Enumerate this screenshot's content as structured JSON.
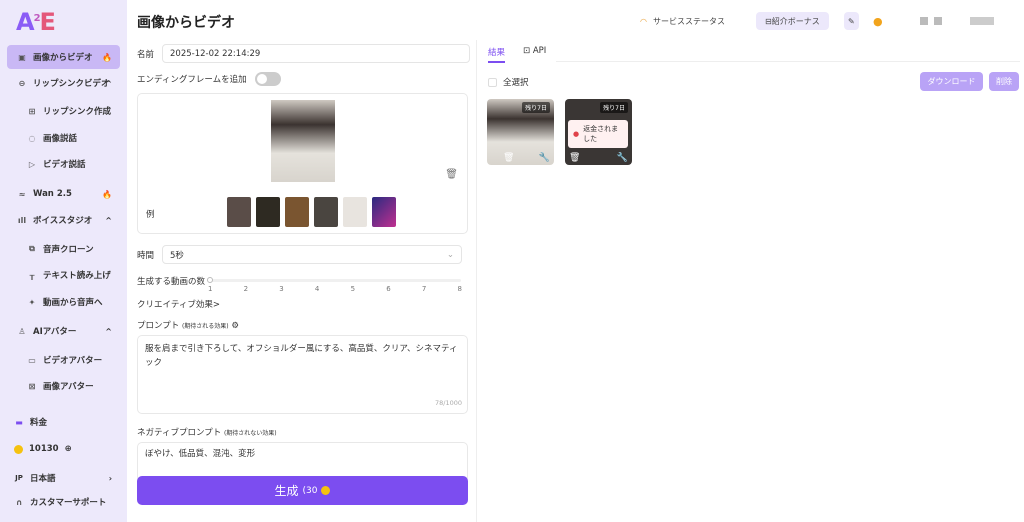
{
  "sidebar": {
    "logo": "A2E",
    "items": [
      {
        "label": "画像からビデオ",
        "icon": "image-video-icon"
      },
      {
        "label": "リップシンクビデオ",
        "icon": "lips-icon"
      },
      {
        "label": "リップシンク作成",
        "icon": "plus-square-icon"
      },
      {
        "label": "画像説話",
        "icon": "talk-icon"
      },
      {
        "label": "ビデオ説話",
        "icon": "video-talk-icon"
      },
      {
        "label": "Wan 2.5",
        "icon": "wan-icon"
      },
      {
        "label": "ボイススタジオ",
        "icon": "waveform-icon"
      },
      {
        "label": "音声クローン",
        "icon": "clone-icon"
      },
      {
        "label": "テキスト読み上げ",
        "icon": "tts-icon"
      },
      {
        "label": "動画から音声へ",
        "icon": "sparkle-icon"
      },
      {
        "label": "AIアバター",
        "icon": "user-icon"
      },
      {
        "label": "ビデオアバター",
        "icon": "video-avatar-icon"
      },
      {
        "label": "画像アバター",
        "icon": "image-avatar-icon"
      },
      {
        "label": "料金",
        "icon": "card-icon"
      },
      {
        "label": "10130",
        "icon": "coin-icon"
      },
      {
        "label": "日本語",
        "prefix": "JP"
      },
      {
        "label": "カスタマーサポート",
        "icon": "headset-icon"
      }
    ]
  },
  "header": {
    "title": "画像からビデオ",
    "status": "サービスステータス",
    "referral": "紹介ボーナス"
  },
  "form": {
    "name_label": "名前",
    "name_value": "2025-12-02 22:14:29",
    "ending_frame_label": "エンディングフレームを追加",
    "example_label": "例",
    "duration_label": "時間",
    "duration_value": "5秒",
    "count_label": "生成する動画の数",
    "count_ticks": [
      "1",
      "2",
      "3",
      "4",
      "5",
      "6",
      "7",
      "8"
    ],
    "count_value": 1,
    "creative_label": "クリエイティブ効果>",
    "prompt_label": "プロンプト",
    "prompt_hint": "(期待される効果)",
    "prompt_value": "服を肩まで引き下ろして、オフショルダー風にする、高品質、クリア、シネマティック",
    "prompt_count": "78/1000",
    "neg_label": "ネガティブプロンプト",
    "neg_hint": "(期待されない効果)",
    "neg_value": "ぼやけ、低品質、混沌、変形",
    "generate_label": "生成",
    "generate_cost": "(30"
  },
  "results": {
    "tabs": [
      "結果",
      "API"
    ],
    "select_all": "全選択",
    "download": "ダウンロード",
    "delete": "削除",
    "items": [
      {
        "badge": "残り7日"
      },
      {
        "badge": "残り7日",
        "status": "返金されました"
      }
    ]
  },
  "colors": {
    "accent": "#7c4df0",
    "sidebar": "#ede9fb"
  }
}
